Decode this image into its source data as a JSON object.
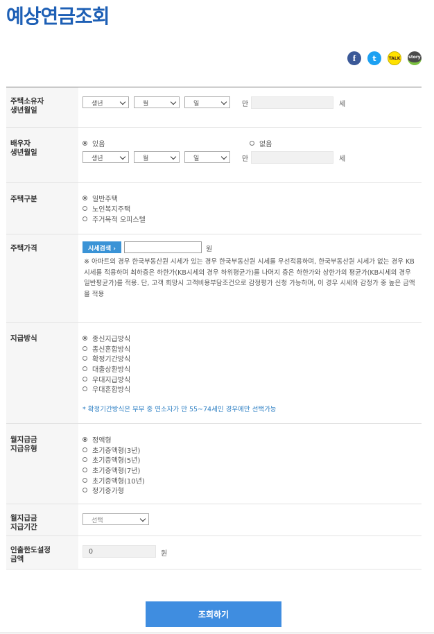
{
  "title": "예상연금조회",
  "share": {
    "facebook": "f",
    "twitter": "t",
    "kakaotalk": "TALK",
    "kakaostory": "story"
  },
  "birth": {
    "label1": "주택소유자",
    "label2": "생년월일",
    "year": "생년",
    "month": "월",
    "day": "일",
    "man": "만",
    "age_unit": "세"
  },
  "spouse": {
    "label1": "배우자",
    "label2": "생년월일",
    "yes": "있음",
    "no": "없음",
    "year": "생년",
    "month": "월",
    "day": "일",
    "man": "만",
    "age_unit": "세"
  },
  "house_type": {
    "label": "주택구분",
    "options": [
      "일반주택",
      "노인복지주택",
      "주거목적 오피스텔"
    ]
  },
  "price": {
    "label": "주택가격",
    "search_button": "시세검색 ›",
    "unit": "원",
    "notice": "※ 아파트의 경우 한국부동산원 시세가 있는 경우 한국부동산원 시세를 우선적용하며, 한국부동산원 시세가 없는 경우 KB시세를 적용하며 최하층은 하한가(KB시세의 경우 하위평균가)를 나머지 층은 하한가와 상한가의 평균가(KB시세의 경우 일반평균가)를 적용. 단, 고객 희망시 고객비용부담조건으로 감정평가 신청 가능하며, 이 경우 시세와 감정가 중 높은 금액을 적용"
  },
  "payment": {
    "label": "지급방식",
    "options": [
      "종신지급방식",
      "종신혼합방식",
      "확정기간방식",
      "대출상환방식",
      "우대지급방식",
      "우대혼합방식"
    ],
    "hint": "* 확정기간방식은 부부 중 연소자가 만 55~74세인 경우에만 선택가능"
  },
  "monthly_type": {
    "label1": "월지급금",
    "label2": "지급유형",
    "options": [
      "정액형",
      "초기증액형(3년)",
      "초기증액형(5년)",
      "초기증액형(7년)",
      "초기증액형(10년)",
      "정기증가형"
    ]
  },
  "monthly_period": {
    "label1": "월지급금",
    "label2": "지급기간",
    "select": "선택"
  },
  "withdraw": {
    "label1": "인출한도설정",
    "label2": "금액",
    "value": "0",
    "unit": "원"
  },
  "submit": "조회하기"
}
